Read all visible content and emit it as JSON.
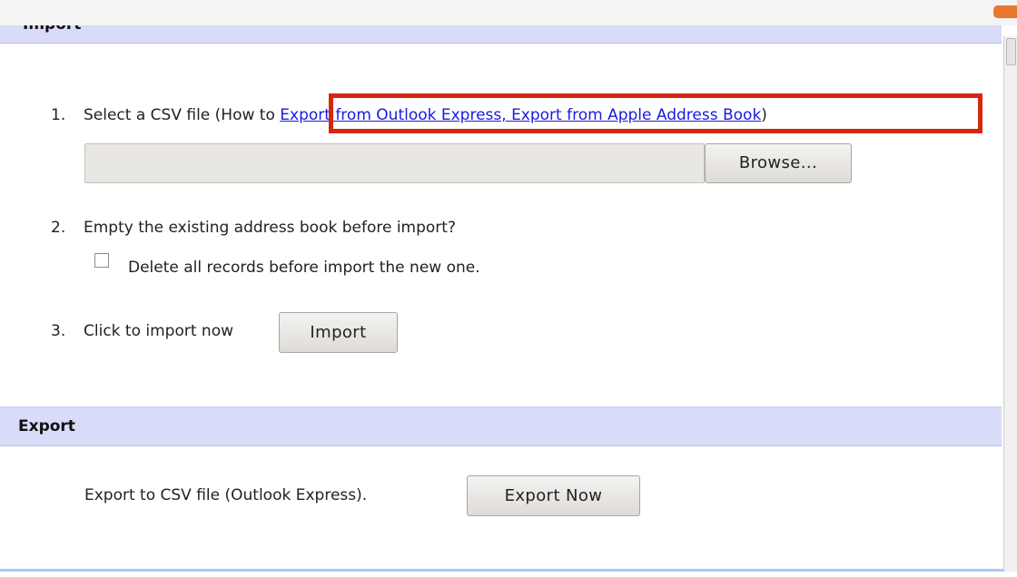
{
  "import_section": {
    "title": "Import",
    "step1": {
      "number": "1.",
      "text": "Select a CSV file (How to ",
      "link": "Export from Outlook Express, Export from Apple Address Book",
      "suffix": ")",
      "browse_label": "Browse..."
    },
    "step2": {
      "number": "2.",
      "text": "Empty the existing address book before import?",
      "checkbox_label": "Delete all records before import the new one."
    },
    "step3": {
      "number": "3.",
      "text": "Click to import now",
      "button_label": "Import"
    }
  },
  "export_section": {
    "title": "Export",
    "text": "Export to CSV file (Outlook Express).",
    "button_label": "Export Now"
  },
  "colors": {
    "section_header_bg": "#d8dcf8",
    "link": "#1a1ae0",
    "highlight": "#d42710"
  }
}
